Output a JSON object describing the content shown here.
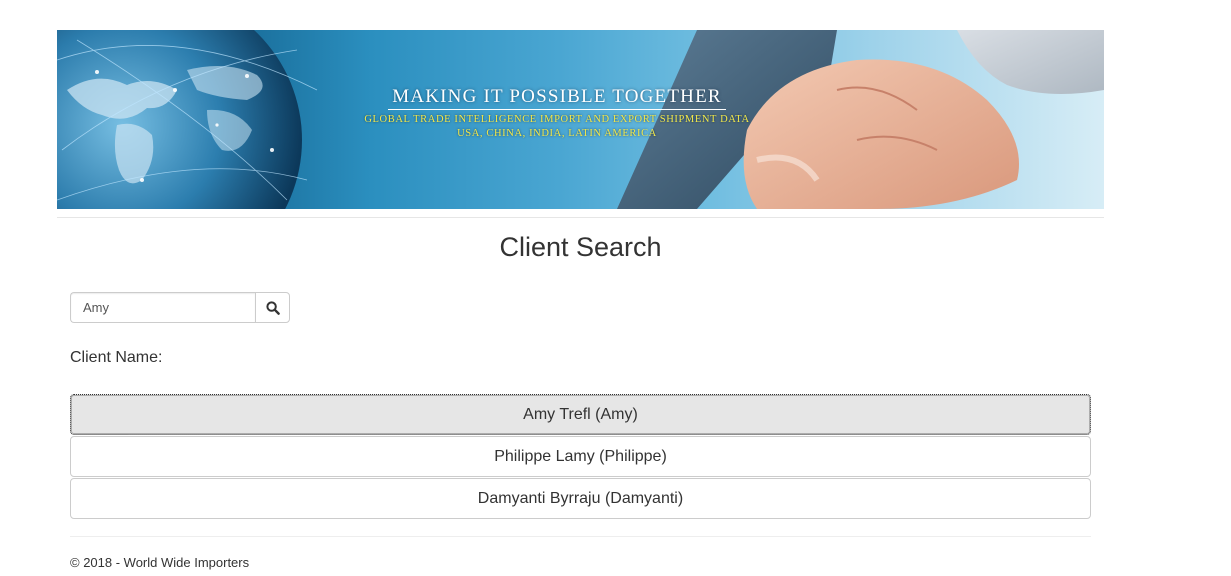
{
  "banner": {
    "title": "MAKING IT POSSIBLE TOGETHER",
    "subtitle": "GLOBAL TRADE INTELLIGENCE IMPORT AND EXPORT SHIPMENT DATA",
    "regions": "USA, CHINA, INDIA, LATIN AMERICA"
  },
  "page": {
    "title": "Client Search"
  },
  "search": {
    "value": "Amy",
    "button_icon": "search-icon"
  },
  "results": {
    "label": "Client Name:",
    "items": [
      {
        "text": "Amy Trefl (Amy)",
        "selected": true
      },
      {
        "text": "Philippe Lamy (Philippe)",
        "selected": false
      },
      {
        "text": "Damyanti Byrraju (Damyanti)",
        "selected": false
      }
    ]
  },
  "footer": {
    "text": "© 2018 - World Wide Importers"
  },
  "colors": {
    "selected_background": "#e6e6e6",
    "border": "#cccccc",
    "banner_text": "#ffffff",
    "banner_accent": "#f2e84a"
  }
}
